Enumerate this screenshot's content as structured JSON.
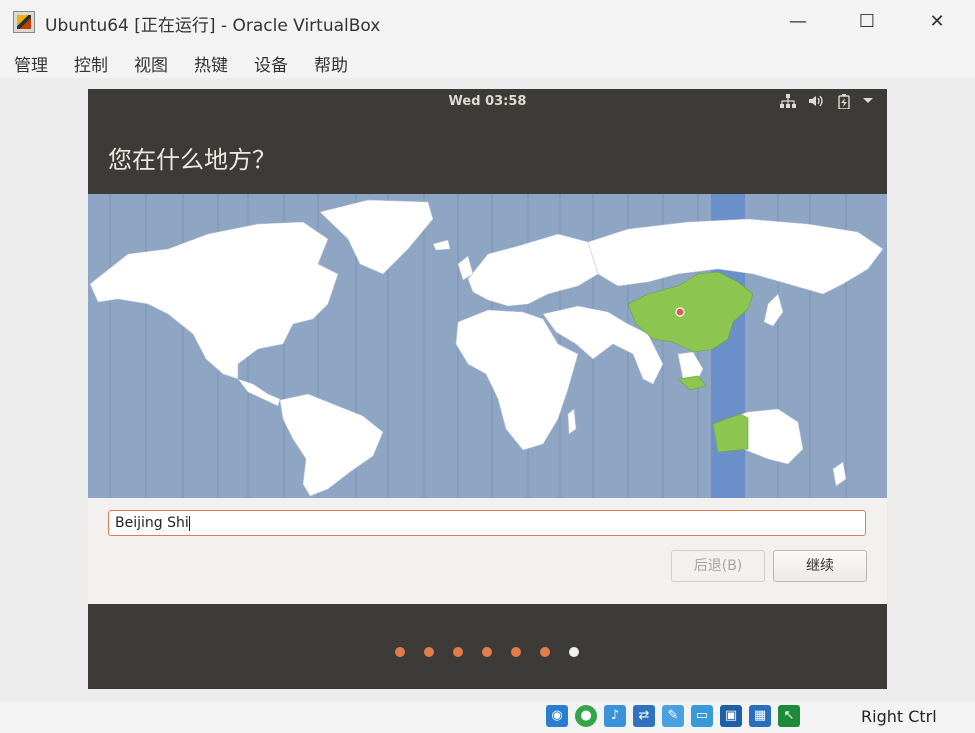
{
  "window": {
    "title": "Ubuntu64 [正在运行] - Oracle VirtualBox",
    "minimize_glyph": "—",
    "maximize_glyph": "☐",
    "close_glyph": "✕"
  },
  "menubar": {
    "items": [
      "管理",
      "控制",
      "视图",
      "热键",
      "设备",
      "帮助"
    ]
  },
  "guest": {
    "topbar": {
      "clock": "Wed 03:58",
      "icons": [
        "network-icon",
        "volume-icon",
        "battery-icon",
        "dropdown-arrow-icon"
      ]
    },
    "header_title": "您在什么地方？",
    "map": {
      "selected_timezone_color": "#6b8fc9",
      "highlight_color": "#8cc550",
      "ocean_color": "#8fa5c4"
    },
    "location_input_value": "Beijing Shi",
    "buttons": {
      "back": "后退(B)",
      "continue": "继续"
    },
    "progress": {
      "total_steps": 7,
      "current_step": 7,
      "done_color": "#e27d4b",
      "current_color": "#f2f1f0"
    }
  },
  "statusbar": {
    "icons": [
      "optical-drive-icon",
      "usb-icon",
      "audio-icon",
      "network-adapter-icon",
      "shared-folders-icon",
      "display-icon",
      "recording-icon",
      "cpu-icon",
      "mouse-integration-icon"
    ],
    "host_key": "Right Ctrl"
  },
  "colors": {
    "ubuntu_dark": "#3c3b37",
    "accent": "#e27d4b"
  }
}
